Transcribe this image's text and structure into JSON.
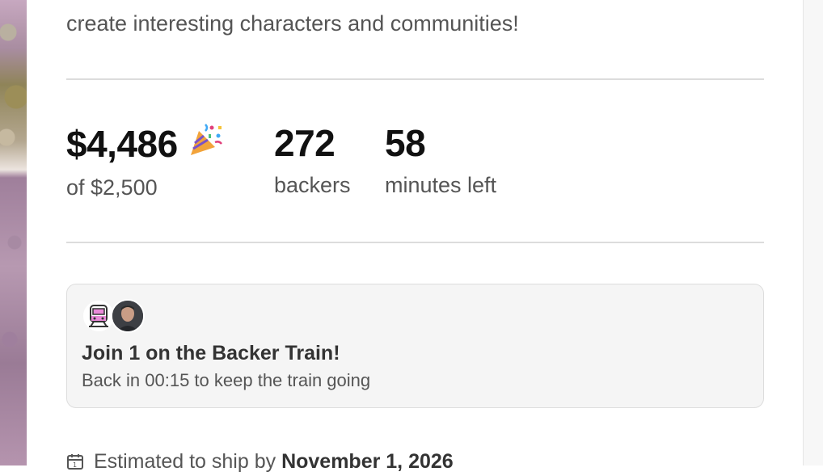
{
  "description": {
    "tail": "create interesting characters and communities!"
  },
  "stats": {
    "pledged": {
      "value": "$4,486",
      "label": "of $2,500",
      "icon": "party-popper-icon"
    },
    "backers": {
      "value": "272",
      "label": "backers"
    },
    "time_left": {
      "value": "58",
      "label": "minutes left"
    }
  },
  "backer_train": {
    "title": "Join 1 on the Backer Train!",
    "subtitle": "Back in 00:15 to keep the train going",
    "icon": "train-icon"
  },
  "shipping": {
    "prefix": "Estimated to ship by ",
    "date": "November 1, 2026",
    "icon": "calendar-icon"
  },
  "colors": {
    "text_primary": "#111111",
    "text_secondary": "#555555",
    "divider": "#dcdcdc",
    "card_bg": "#f5f5f5",
    "train_accent": "#e98ad8"
  }
}
